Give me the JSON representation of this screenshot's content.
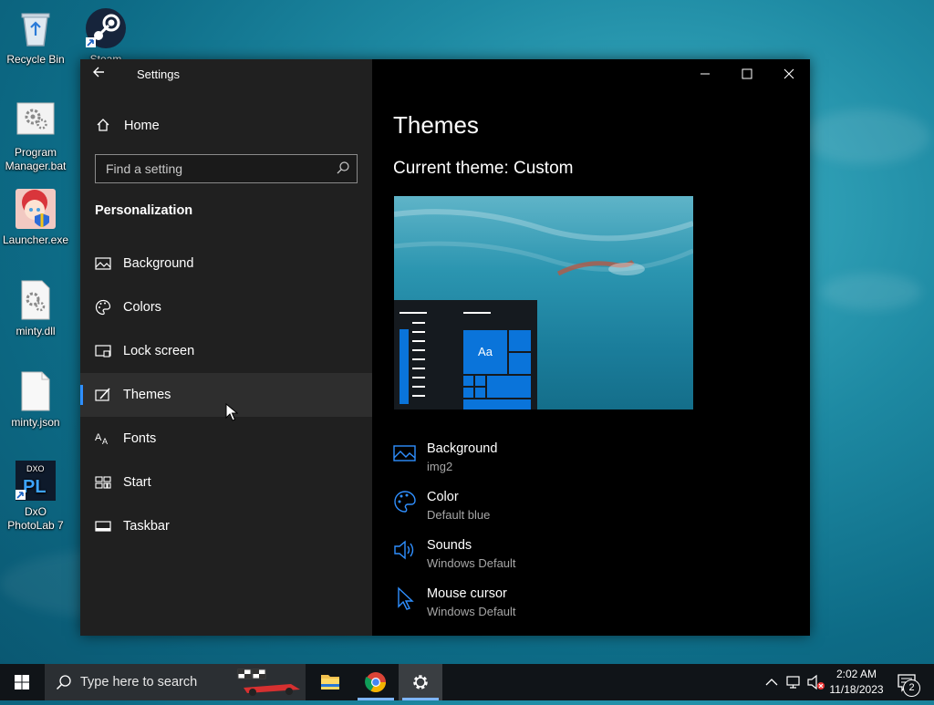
{
  "desktop": {
    "icons": [
      {
        "label": "Recycle Bin"
      },
      {
        "label": "Steam"
      },
      {
        "label": "Program Manager.bat"
      },
      {
        "label": "Launcher.exe"
      },
      {
        "label": "minty.dll"
      },
      {
        "label": "minty.json"
      },
      {
        "label": "DxO PhotoLab 7"
      }
    ]
  },
  "window": {
    "title": "Settings",
    "nav": {
      "home_label": "Home",
      "search_placeholder": "Find a setting",
      "section": "Personalization",
      "items": [
        {
          "label": "Background",
          "icon": "image-icon"
        },
        {
          "label": "Colors",
          "icon": "palette-icon"
        },
        {
          "label": "Lock screen",
          "icon": "lock-screen-icon"
        },
        {
          "label": "Themes",
          "icon": "themes-brush-icon",
          "active": true
        },
        {
          "label": "Fonts",
          "icon": "fonts-icon"
        },
        {
          "label": "Start",
          "icon": "start-icon"
        },
        {
          "label": "Taskbar",
          "icon": "taskbar-icon"
        }
      ]
    },
    "content": {
      "title": "Themes",
      "current_theme": "Current theme: Custom",
      "preview_tile_text": "Aa",
      "properties": [
        {
          "name": "Background",
          "value": "img2",
          "icon": "image-icon"
        },
        {
          "name": "Color",
          "value": "Default blue",
          "icon": "palette-icon"
        },
        {
          "name": "Sounds",
          "value": "Windows Default",
          "icon": "speaker-icon"
        },
        {
          "name": "Mouse cursor",
          "value": "Windows Default",
          "icon": "cursor-icon"
        }
      ]
    },
    "accent_color": "#0a74da"
  },
  "taskbar": {
    "search_placeholder": "Type here to search",
    "apps": [
      "File Explorer",
      "Google Chrome",
      "Settings"
    ],
    "time": "2:02 AM",
    "date": "11/18/2023",
    "notification_count": "2"
  }
}
